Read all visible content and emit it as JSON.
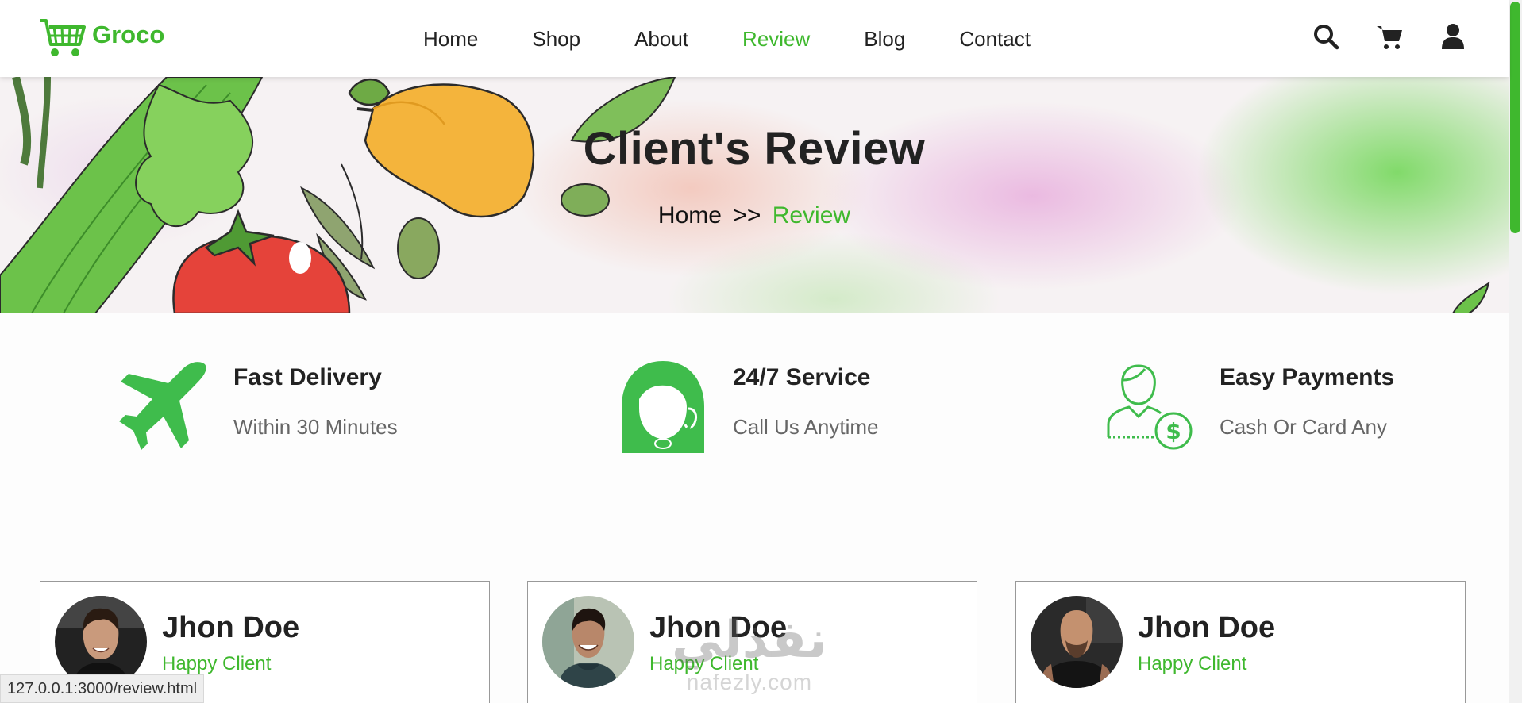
{
  "brand": {
    "name": "Groco",
    "color": "#3fb82e",
    "logo_icon": "cart-icon"
  },
  "nav": {
    "items": [
      {
        "label": "Home",
        "active": false
      },
      {
        "label": "Shop",
        "active": false
      },
      {
        "label": "About",
        "active": false
      },
      {
        "label": "Review",
        "active": true
      },
      {
        "label": "Blog",
        "active": false
      },
      {
        "label": "Contact",
        "active": false
      }
    ],
    "icons": [
      "search-icon",
      "cart-icon",
      "user-icon"
    ]
  },
  "banner": {
    "title": "Client's Review",
    "breadcrumb": {
      "home": "Home",
      "separator": ">>",
      "current": "Review"
    }
  },
  "features": [
    {
      "icon": "airplane-icon",
      "title": "Fast Delivery",
      "subtitle": "Within 30 Minutes"
    },
    {
      "icon": "headset-agent-icon",
      "title": "24/7 Service",
      "subtitle": "Call Us Anytime"
    },
    {
      "icon": "payment-person-icon",
      "title": "Easy Payments",
      "subtitle": "Cash Or Card Any"
    }
  ],
  "reviews": [
    {
      "name": "Jhon Doe",
      "role": "Happy Client"
    },
    {
      "name": "Jhon Doe",
      "role": "Happy Client"
    },
    {
      "name": "Jhon Doe",
      "role": "Happy Client"
    }
  ],
  "status_bar": {
    "url": "127.0.0.1:3000/review.html"
  },
  "watermark": {
    "arabic": "نفذلي",
    "latin": "nafezly.com"
  }
}
